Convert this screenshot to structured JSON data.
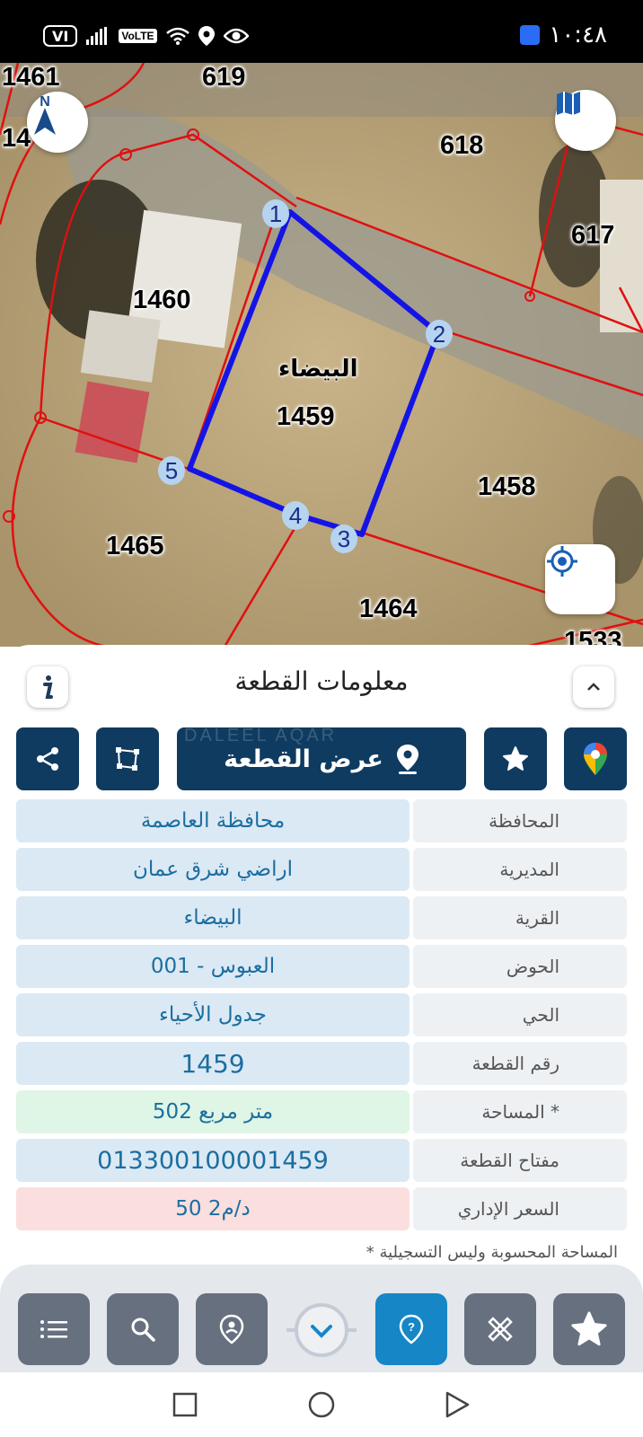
{
  "status_bar": {
    "time": "١٠:٤٨",
    "sim": "VI",
    "volte": "VoLTE"
  },
  "map": {
    "parcels": [
      {
        "id": "p1461",
        "label": "1461"
      },
      {
        "id": "p619",
        "label": "619"
      },
      {
        "id": "p14xx",
        "label": "14"
      },
      {
        "id": "p618",
        "label": "618"
      },
      {
        "id": "p617",
        "label": "617"
      },
      {
        "id": "p1460",
        "label": "1460"
      },
      {
        "id": "p1459",
        "label": "1459"
      },
      {
        "id": "p1458",
        "label": "1458"
      },
      {
        "id": "p1465",
        "label": "1465"
      },
      {
        "id": "p1464",
        "label": "1464"
      },
      {
        "id": "p1533",
        "label": "1533"
      }
    ],
    "village_label": "البيضاء",
    "vertices": [
      "1",
      "2",
      "3",
      "4",
      "5"
    ],
    "compass_letter": "N"
  },
  "panel": {
    "title": "معلومات القطعة",
    "view_parcel_label": "عرض القطعة",
    "watermark": "DALEEL AQAR",
    "rows": [
      {
        "label": "المحافظة",
        "value": "محافظة العاصمة",
        "tone": "blue"
      },
      {
        "label": "المديرية",
        "value": "اراضي شرق عمان",
        "tone": "blue"
      },
      {
        "label": "القرية",
        "value": "البيضاء",
        "tone": "blue"
      },
      {
        "label": "الحوض",
        "value": "العبوس - 001",
        "tone": "blue"
      },
      {
        "label": "الحي",
        "value": "جدول الأحياء",
        "tone": "blue"
      },
      {
        "label": "رقم القطعة",
        "value": "1459",
        "tone": "blue"
      },
      {
        "label": "المساحة *",
        "value": "502  متر مربع",
        "tone": "green"
      },
      {
        "label": "مفتاح القطعة",
        "value": "013300100001459",
        "tone": "blue"
      },
      {
        "label": "السعر الإداري",
        "value": "50 د/م2",
        "tone": "red"
      }
    ],
    "note": "* المساحة المحسوبة وليس التسجيلية"
  },
  "colors": {
    "primary": "#0f3b61",
    "row_blue": "#dbe9f4",
    "row_green": "#dff5e5",
    "row_red": "#fbdede",
    "label_bg": "#eef1f4",
    "value_text": "#1b6ea0",
    "parcel_outline": "#1414e6",
    "boundary": "#e01010",
    "accent_active": "#1686c6"
  }
}
